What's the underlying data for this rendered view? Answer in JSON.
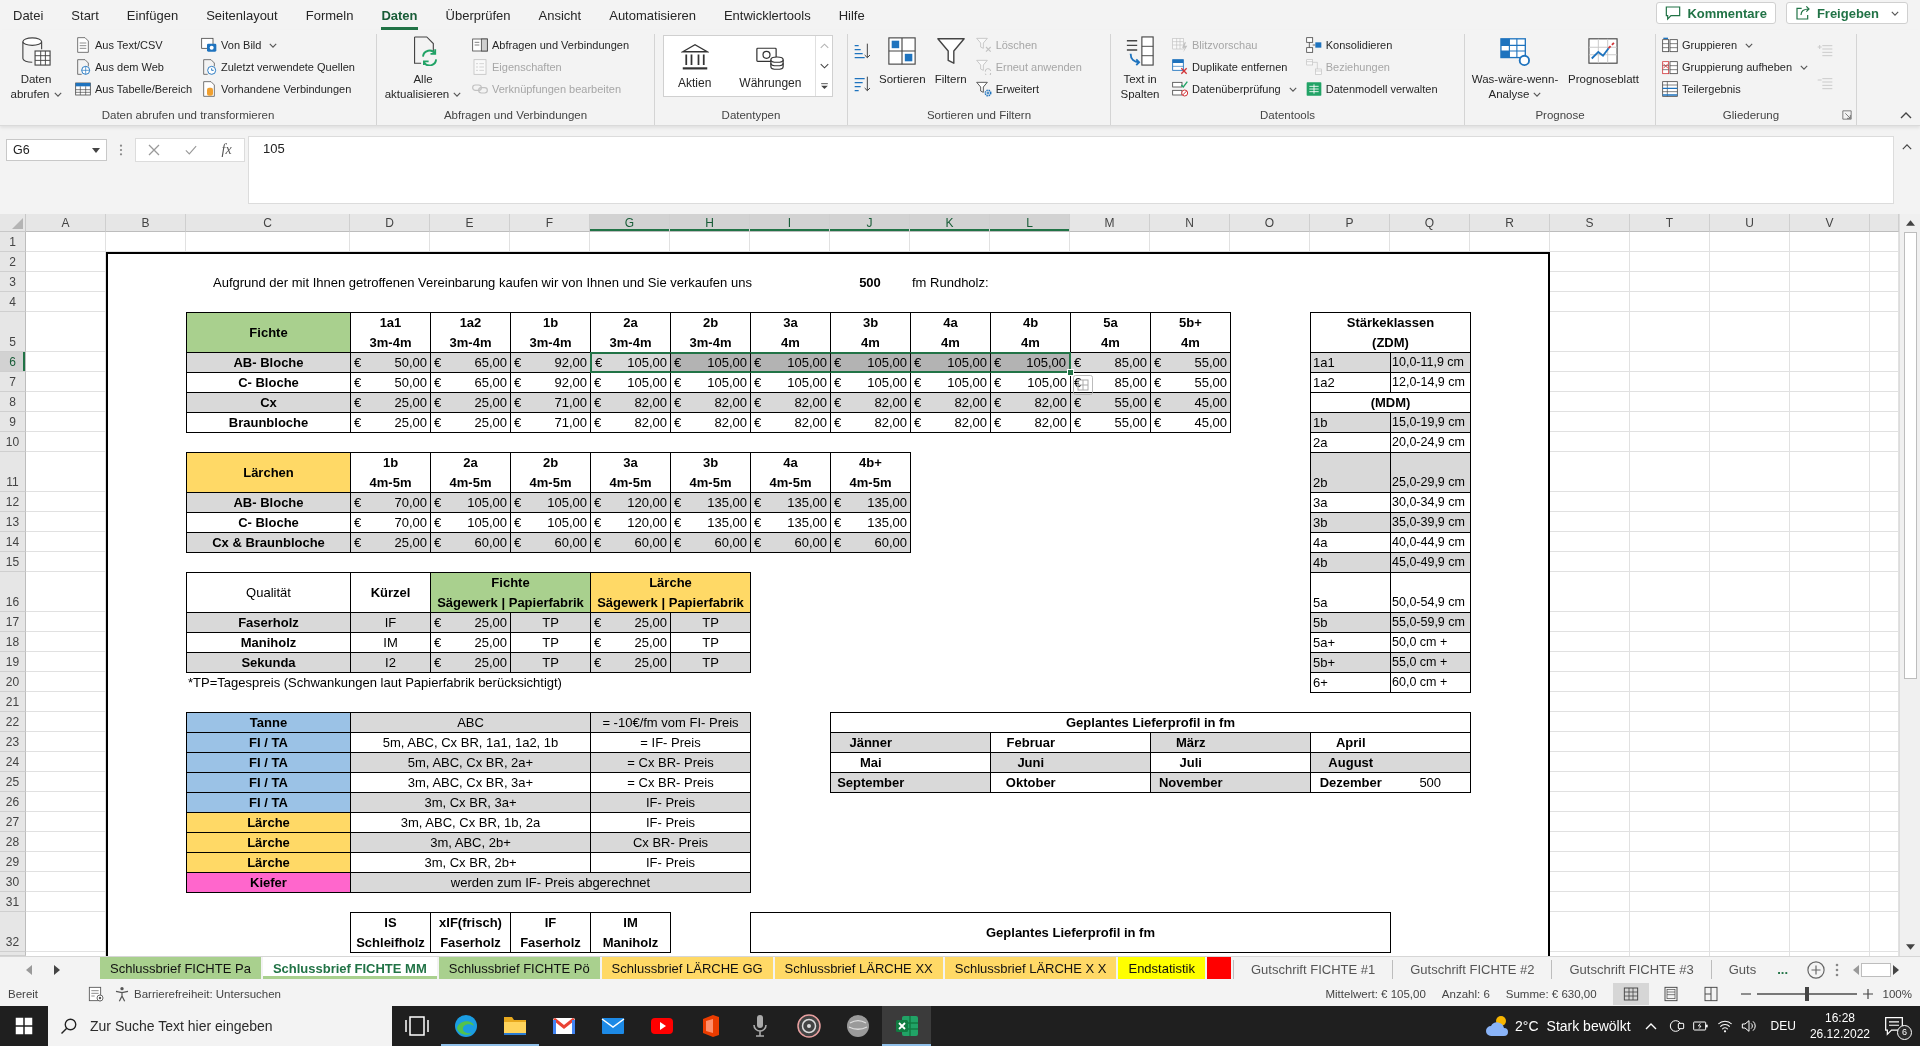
{
  "menu_tabs": [
    {
      "label": "Datei",
      "selected": false
    },
    {
      "label": "Start",
      "selected": false
    },
    {
      "label": "Einfügen",
      "selected": false
    },
    {
      "label": "Seitenlayout",
      "selected": false
    },
    {
      "label": "Formeln",
      "selected": false
    },
    {
      "label": "Daten",
      "selected": true
    },
    {
      "label": "Überprüfen",
      "selected": false
    },
    {
      "label": "Ansicht",
      "selected": false
    },
    {
      "label": "Automatisieren",
      "selected": false
    },
    {
      "label": "Entwicklertools",
      "selected": false
    },
    {
      "label": "Hilfe",
      "selected": false
    }
  ],
  "header_buttons": [
    {
      "kind": "comments",
      "label": "Kommentare",
      "dropdown": false
    },
    {
      "kind": "share",
      "label": "Freigeben",
      "dropdown": true
    }
  ],
  "ribbon_groups": [
    {
      "label": "Daten abrufen und transformieren",
      "launcher": false,
      "items": [
        {
          "kind": "large",
          "label": "Daten abrufen",
          "dropdown": true,
          "disabled": false
        },
        {
          "kind": "small",
          "label": "Aus Text/CSV",
          "dropdown": false,
          "disabled": false
        },
        {
          "kind": "small",
          "label": "Aus dem Web",
          "dropdown": false,
          "disabled": false
        },
        {
          "kind": "small",
          "label": "Aus Tabelle/Bereich",
          "dropdown": false,
          "disabled": false
        },
        {
          "kind": "small",
          "label": "Von Bild",
          "dropdown": true,
          "disabled": false
        },
        {
          "kind": "small",
          "label": "Zuletzt verwendete Quellen",
          "dropdown": false,
          "disabled": false
        },
        {
          "kind": "small",
          "label": "Vorhandene Verbindungen",
          "dropdown": false,
          "disabled": false
        }
      ]
    },
    {
      "label": "Abfragen und Verbindungen",
      "launcher": false,
      "items": [
        {
          "kind": "large",
          "label": "Alle aktualisieren",
          "dropdown": true,
          "disabled": false
        },
        {
          "kind": "small",
          "label": "Abfragen und Verbindungen",
          "dropdown": false,
          "disabled": false
        },
        {
          "kind": "small",
          "label": "Eigenschaften",
          "dropdown": false,
          "disabled": true
        },
        {
          "kind": "small",
          "label": "Verknüpfungen bearbeiten",
          "dropdown": false,
          "disabled": true
        }
      ]
    },
    {
      "label": "Datentypen",
      "launcher": false,
      "items": [
        {
          "kind": "tile",
          "label": "Aktien",
          "dropdown": false,
          "disabled": false
        },
        {
          "kind": "tile",
          "label": "Währungen",
          "dropdown": false,
          "disabled": false
        }
      ]
    },
    {
      "label": "Sortieren und Filtern",
      "launcher": false,
      "items": [
        {
          "kind": "icon",
          "dropdown": false,
          "disabled": false
        },
        {
          "kind": "icon",
          "dropdown": false,
          "disabled": false
        },
        {
          "kind": "large",
          "label": "Sortieren",
          "dropdown": false,
          "disabled": false
        },
        {
          "kind": "large",
          "label": "Filtern",
          "dropdown": false,
          "disabled": false
        },
        {
          "kind": "small",
          "label": "Löschen",
          "dropdown": false,
          "disabled": true
        },
        {
          "kind": "small",
          "label": "Erneut anwenden",
          "dropdown": false,
          "disabled": true
        },
        {
          "kind": "small",
          "label": "Erweitert",
          "dropdown": false,
          "disabled": false
        }
      ]
    },
    {
      "label": "Datentools",
      "launcher": false,
      "items": [
        {
          "kind": "large",
          "label": "Text in Spalten",
          "dropdown": false,
          "disabled": false
        },
        {
          "kind": "small",
          "label": "Blitzvorschau",
          "dropdown": false,
          "disabled": true
        },
        {
          "kind": "small",
          "label": "Duplikate entfernen",
          "dropdown": false,
          "disabled": false
        },
        {
          "kind": "small",
          "label": "Datenüberprüfung",
          "dropdown": true,
          "disabled": false
        },
        {
          "kind": "small",
          "label": "Konsolidieren",
          "dropdown": false,
          "disabled": false
        },
        {
          "kind": "small",
          "label": "Beziehungen",
          "dropdown": false,
          "disabled": true
        },
        {
          "kind": "small",
          "label": "Datenmodell verwalten",
          "dropdown": false,
          "disabled": false
        }
      ]
    },
    {
      "label": "Prognose",
      "launcher": false,
      "items": [
        {
          "kind": "large",
          "label": "Was-wäre-wenn-Analyse",
          "dropdown": true,
          "disabled": false
        },
        {
          "kind": "large",
          "label": "Prognoseblatt",
          "dropdown": false,
          "disabled": false
        }
      ]
    },
    {
      "label": "Gliederung",
      "launcher": true,
      "items": [
        {
          "kind": "small",
          "label": "Gruppieren",
          "dropdown": true,
          "disabled": false
        },
        {
          "kind": "small",
          "label": "Gruppierung aufheben",
          "dropdown": true,
          "disabled": false
        },
        {
          "kind": "small",
          "label": "Teilergebnis",
          "dropdown": false,
          "disabled": false
        },
        {
          "kind": "icon",
          "dropdown": false,
          "disabled": true
        },
        {
          "kind": "icon",
          "dropdown": false,
          "disabled": true
        }
      ]
    }
  ],
  "formula_bar": {
    "name_box": "G6",
    "function_label": "fx",
    "value": "105"
  },
  "columns": [
    {
      "label": "A",
      "selected": false
    },
    {
      "label": "B",
      "selected": false
    },
    {
      "label": "C",
      "selected": false
    },
    {
      "label": "D",
      "selected": false
    },
    {
      "label": "E",
      "selected": false
    },
    {
      "label": "F",
      "selected": false
    },
    {
      "label": "G",
      "selected": true
    },
    {
      "label": "H",
      "selected": true
    },
    {
      "label": "I",
      "selected": true
    },
    {
      "label": "J",
      "selected": true
    },
    {
      "label": "K",
      "selected": true
    },
    {
      "label": "L",
      "selected": true
    },
    {
      "label": "M",
      "selected": false
    },
    {
      "label": "N",
      "selected": false
    },
    {
      "label": "O",
      "selected": false
    },
    {
      "label": "P",
      "selected": false
    },
    {
      "label": "Q",
      "selected": false
    },
    {
      "label": "R",
      "selected": false
    },
    {
      "label": "S",
      "selected": false
    },
    {
      "label": "T",
      "selected": false
    },
    {
      "label": "U",
      "selected": false
    },
    {
      "label": "V",
      "selected": false
    }
  ],
  "rows": [
    {
      "label": "1",
      "selected": false
    },
    {
      "label": "2",
      "selected": false
    },
    {
      "label": "3",
      "selected": false
    },
    {
      "label": "4",
      "selected": false
    },
    {
      "label": "5",
      "selected": false
    },
    {
      "label": "6",
      "selected": true
    },
    {
      "label": "7",
      "selected": false
    },
    {
      "label": "8",
      "selected": false
    },
    {
      "label": "9",
      "selected": false
    },
    {
      "label": "10",
      "selected": false
    },
    {
      "label": "11",
      "selected": false
    },
    {
      "label": "12",
      "selected": false
    },
    {
      "label": "13",
      "selected": false
    },
    {
      "label": "14",
      "selected": false
    },
    {
      "label": "15",
      "selected": false
    },
    {
      "label": "16",
      "selected": false
    },
    {
      "label": "17",
      "selected": false
    },
    {
      "label": "18",
      "selected": false
    },
    {
      "label": "19",
      "selected": false
    },
    {
      "label": "20",
      "selected": false
    },
    {
      "label": "21",
      "selected": false
    },
    {
      "label": "22",
      "selected": false
    },
    {
      "label": "23",
      "selected": false
    },
    {
      "label": "24",
      "selected": false
    },
    {
      "label": "25",
      "selected": false
    },
    {
      "label": "26",
      "selected": false
    },
    {
      "label": "27",
      "selected": false
    },
    {
      "label": "28",
      "selected": false
    },
    {
      "label": "29",
      "selected": false
    },
    {
      "label": "30",
      "selected": false
    },
    {
      "label": "31",
      "selected": false
    },
    {
      "label": "32",
      "selected": false
    }
  ],
  "sheet": {
    "intro": {
      "text": "Aufgrund der mit Ihnen getroffenen Vereinbarung kaufen wir von Ihnen und Sie verkaufen uns",
      "amount": "500",
      "unit": "fm Rundholz:"
    },
    "price_tables": [
      {
        "title": "Fichte",
        "color": "#a9d08e",
        "columns": [
          {
            "grade": "1a1",
            "length": "3m-4m"
          },
          {
            "grade": "1a2",
            "length": "3m-4m"
          },
          {
            "grade": "1b",
            "length": "3m-4m"
          },
          {
            "grade": "2a",
            "length": "3m-4m"
          },
          {
            "grade": "2b",
            "length": "3m-4m"
          },
          {
            "grade": "3a",
            "length": "4m"
          },
          {
            "grade": "3b",
            "length": "4m"
          },
          {
            "grade": "4a",
            "length": "4m"
          },
          {
            "grade": "4b",
            "length": "4m"
          },
          {
            "grade": "5a",
            "length": "4m"
          },
          {
            "grade": "5b+",
            "length": "4m"
          }
        ],
        "rows": [
          {
            "label": "AB- Bloche",
            "shaded": true,
            "values": [
              {
                "currency": "€",
                "amount": "50,00",
                "selected": false
              },
              {
                "currency": "€",
                "amount": "65,00",
                "selected": false
              },
              {
                "currency": "€",
                "amount": "92,00",
                "selected": false
              },
              {
                "currency": "€",
                "amount": "105,00",
                "selected": true
              },
              {
                "currency": "€",
                "amount": "105,00",
                "selected": true
              },
              {
                "currency": "€",
                "amount": "105,00",
                "selected": true
              },
              {
                "currency": "€",
                "amount": "105,00",
                "selected": true
              },
              {
                "currency": "€",
                "amount": "105,00",
                "selected": true
              },
              {
                "currency": "€",
                "amount": "105,00",
                "selected": true
              },
              {
                "currency": "€",
                "amount": "85,00",
                "selected": false
              },
              {
                "currency": "€",
                "amount": "55,00",
                "selected": false
              }
            ]
          },
          {
            "label": "C- Bloche",
            "shaded": false,
            "values": [
              {
                "currency": "€",
                "amount": "50,00",
                "selected": false
              },
              {
                "currency": "€",
                "amount": "65,00",
                "selected": false
              },
              {
                "currency": "€",
                "amount": "92,00",
                "selected": false
              },
              {
                "currency": "€",
                "amount": "105,00",
                "selected": false
              },
              {
                "currency": "€",
                "amount": "105,00",
                "selected": false
              },
              {
                "currency": "€",
                "amount": "105,00",
                "selected": false
              },
              {
                "currency": "€",
                "amount": "105,00",
                "selected": false
              },
              {
                "currency": "€",
                "amount": "105,00",
                "selected": false
              },
              {
                "currency": "€",
                "amount": "105,00",
                "selected": false
              },
              {
                "currency": "€",
                "amount": "85,00",
                "selected": false
              },
              {
                "currency": "€",
                "amount": "55,00",
                "selected": false
              }
            ]
          },
          {
            "label": "Cx",
            "shaded": true,
            "values": [
              {
                "currency": "€",
                "amount": "25,00",
                "selected": false
              },
              {
                "currency": "€",
                "amount": "25,00",
                "selected": false
              },
              {
                "currency": "€",
                "amount": "71,00",
                "selected": false
              },
              {
                "currency": "€",
                "amount": "82,00",
                "selected": false
              },
              {
                "currency": "€",
                "amount": "82,00",
                "selected": false
              },
              {
                "currency": "€",
                "amount": "82,00",
                "selected": false
              },
              {
                "currency": "€",
                "amount": "82,00",
                "selected": false
              },
              {
                "currency": "€",
                "amount": "82,00",
                "selected": false
              },
              {
                "currency": "€",
                "amount": "82,00",
                "selected": false
              },
              {
                "currency": "€",
                "amount": "55,00",
                "selected": false
              },
              {
                "currency": "€",
                "amount": "45,00",
                "selected": false
              }
            ]
          },
          {
            "label": "Braunbloche",
            "shaded": false,
            "values": [
              {
                "currency": "€",
                "amount": "25,00",
                "selected": false
              },
              {
                "currency": "€",
                "amount": "25,00",
                "selected": false
              },
              {
                "currency": "€",
                "amount": "71,00",
                "selected": false
              },
              {
                "currency": "€",
                "amount": "82,00",
                "selected": false
              },
              {
                "currency": "€",
                "amount": "82,00",
                "selected": false
              },
              {
                "currency": "€",
                "amount": "82,00",
                "selected": false
              },
              {
                "currency": "€",
                "amount": "82,00",
                "selected": false
              },
              {
                "currency": "€",
                "amount": "82,00",
                "selected": false
              },
              {
                "currency": "€",
                "amount": "82,00",
                "selected": false
              },
              {
                "currency": "€",
                "amount": "55,00",
                "selected": false
              },
              {
                "currency": "€",
                "amount": "45,00",
                "selected": false
              }
            ]
          }
        ]
      },
      {
        "title": "Lärchen",
        "color": "#ffd966",
        "columns": [
          {
            "grade": "1b",
            "length": "4m-5m"
          },
          {
            "grade": "2a",
            "length": "4m-5m"
          },
          {
            "grade": "2b",
            "length": "4m-5m"
          },
          {
            "grade": "3a",
            "length": "4m-5m"
          },
          {
            "grade": "3b",
            "length": "4m-5m"
          },
          {
            "grade": "4a",
            "length": "4m-5m"
          },
          {
            "grade": "4b+",
            "length": "4m-5m"
          }
        ],
        "rows": [
          {
            "label": "AB- Bloche",
            "shaded": true,
            "values": [
              {
                "currency": "€",
                "amount": "70,00"
              },
              {
                "currency": "€",
                "amount": "105,00"
              },
              {
                "currency": "€",
                "amount": "105,00"
              },
              {
                "currency": "€",
                "amount": "120,00"
              },
              {
                "currency": "€",
                "amount": "135,00"
              },
              {
                "currency": "€",
                "amount": "135,00"
              },
              {
                "currency": "€",
                "amount": "135,00"
              }
            ]
          },
          {
            "label": "C- Bloche",
            "shaded": false,
            "values": [
              {
                "currency": "€",
                "amount": "70,00"
              },
              {
                "currency": "€",
                "amount": "105,00"
              },
              {
                "currency": "€",
                "amount": "105,00"
              },
              {
                "currency": "€",
                "amount": "120,00"
              },
              {
                "currency": "€",
                "amount": "135,00"
              },
              {
                "currency": "€",
                "amount": "135,00"
              },
              {
                "currency": "€",
                "amount": "135,00"
              }
            ]
          },
          {
            "label": "Cx & Braunbloche",
            "shaded": true,
            "values": [
              {
                "currency": "€",
                "amount": "25,00"
              },
              {
                "currency": "€",
                "amount": "60,00"
              },
              {
                "currency": "€",
                "amount": "60,00"
              },
              {
                "currency": "€",
                "amount": "60,00"
              },
              {
                "currency": "€",
                "amount": "60,00"
              },
              {
                "currency": "€",
                "amount": "60,00"
              },
              {
                "currency": "€",
                "amount": "60,00"
              }
            ]
          }
        ]
      }
    ],
    "quality_table": {
      "headers": [
        "Qualität",
        "Kürzel"
      ],
      "groups": [
        {
          "title": "Fichte",
          "subtitle": "Sägewerk | Papierfabrik",
          "color": "#a9d08e"
        },
        {
          "title": "Lärche",
          "subtitle": "Sägewerk | Papierfabrik",
          "color": "#ffd966"
        }
      ],
      "rows": [
        {
          "label": "Faserholz",
          "code": "IF",
          "shaded": true,
          "prices": [
            {
              "currency": "€",
              "amount": "25,00",
              "paper_mill": "TP"
            },
            {
              "currency": "€",
              "amount": "25,00",
              "paper_mill": "TP"
            }
          ]
        },
        {
          "label": "Maniholz",
          "code": "IM",
          "shaded": false,
          "prices": [
            {
              "currency": "€",
              "amount": "25,00",
              "paper_mill": "TP"
            },
            {
              "currency": "€",
              "amount": "25,00",
              "paper_mill": "TP"
            }
          ]
        },
        {
          "label": "Sekunda",
          "code": "I2",
          "shaded": true,
          "prices": [
            {
              "currency": "€",
              "amount": "25,00",
              "paper_mill": "TP"
            },
            {
              "currency": "€",
              "amount": "25,00",
              "paper_mill": "TP"
            }
          ]
        }
      ]
    },
    "footnote": "*TP=Tagespreis (Schwankungen laut Papierfabrik berücksichtigt)",
    "rules": [
      {
        "kind": "split",
        "species": "Tanne",
        "color": "#9bc2e6",
        "assortment": "ABC",
        "price": "= -10€/fm vom FI- Preis",
        "shaded": true
      },
      {
        "kind": "split",
        "species": "FI / TA",
        "color": "#9bc2e6",
        "assortment": "5m, ABC, Cx BR, 1a1, 1a2, 1b",
        "price": "= IF- Preis",
        "shaded": false
      },
      {
        "kind": "split",
        "species": "FI / TA",
        "color": "#9bc2e6",
        "assortment": "5m, ABC, Cx BR, 2a+",
        "price": "= Cx BR- Preis",
        "shaded": true
      },
      {
        "kind": "split",
        "species": "FI / TA",
        "color": "#9bc2e6",
        "assortment": "3m, ABC, Cx BR, 3a+",
        "price": "= Cx BR- Preis",
        "shaded": false
      },
      {
        "kind": "split",
        "species": "FI / TA",
        "color": "#9bc2e6",
        "assortment": "3m, Cx BR, 3a+",
        "price": "IF- Preis",
        "shaded": true
      },
      {
        "kind": "split",
        "species": "Lärche",
        "color": "#ffd966",
        "assortment": "3m, ABC, Cx BR, 1b, 2a",
        "price": "IF- Preis",
        "shaded": false
      },
      {
        "kind": "split",
        "species": "Lärche",
        "color": "#ffd966",
        "assortment": "3m, ABC, 2b+",
        "price": "Cx BR- Preis",
        "shaded": true
      },
      {
        "kind": "split",
        "species": "Lärche",
        "color": "#ffd966",
        "assortment": "3m, Cx BR, 2b+",
        "price": "IF- Preis",
        "shaded": false
      },
      {
        "kind": "merged",
        "species": "Kiefer",
        "color": "#ff66cc",
        "note": "werden zum IF- Preis abgerechnet",
        "shaded": true
      }
    ],
    "diameter_classes": {
      "title": "Stärkeklassen",
      "subtitle": "(ZDM)",
      "rows": [
        {
          "kind": "class",
          "grade": "1a1",
          "range": "10,0-11,9 cm",
          "shaded": true
        },
        {
          "kind": "class",
          "grade": "1a2",
          "range": "12,0-14,9 cm",
          "shaded": false
        },
        {
          "kind": "heading",
          "label": "(MDM)",
          "shaded": false
        },
        {
          "kind": "class",
          "grade": "1b",
          "range": "15,0-19,9 cm",
          "shaded": true
        },
        {
          "kind": "class",
          "grade": "2a",
          "range": "20,0-24,9 cm",
          "shaded": false
        },
        {
          "kind": "class",
          "grade": "2b",
          "range": "25,0-29,9 cm",
          "shaded": true
        },
        {
          "kind": "class",
          "grade": "3a",
          "range": "30,0-34,9 cm",
          "shaded": false
        },
        {
          "kind": "class",
          "grade": "3b",
          "range": "35,0-39,9 cm",
          "shaded": true
        },
        {
          "kind": "class",
          "grade": "4a",
          "range": "40,0-44,9 cm",
          "shaded": false
        },
        {
          "kind": "class",
          "grade": "4b",
          "range": "45,0-49,9 cm",
          "shaded": true
        },
        {
          "kind": "class",
          "grade": "5a",
          "range": "50,0-54,9 cm",
          "shaded": false
        },
        {
          "kind": "class",
          "grade": "5b",
          "range": "55,0-59,9 cm",
          "shaded": true
        },
        {
          "kind": "class",
          "grade": "5a+",
          "range": "50,0 cm +",
          "shaded": false
        },
        {
          "kind": "class",
          "grade": "5b+",
          "range": "55,0 cm +",
          "shaded": true
        },
        {
          "kind": "class",
          "grade": "6+",
          "range": "60,0 cm +",
          "shaded": false
        }
      ]
    },
    "delivery_profile": {
      "title": "Geplantes Lieferprofil in fm",
      "months": [
        {
          "name": "Jänner",
          "shaded": true
        },
        {
          "name": "Februar",
          "shaded": false
        },
        {
          "name": "März",
          "shaded": true
        },
        {
          "name": "April",
          "shaded": false
        },
        {
          "name": "Mai",
          "shaded": false
        },
        {
          "name": "Juni",
          "shaded": true
        },
        {
          "name": "Juli",
          "shaded": false
        },
        {
          "name": "August",
          "shaded": true
        },
        {
          "name": "September",
          "shaded": true
        },
        {
          "name": "Oktober",
          "shaded": false
        },
        {
          "name": "November",
          "shaded": true
        },
        {
          "name": "Dezember",
          "value": "500",
          "shaded": false
        }
      ]
    },
    "assortment_headers": [
      {
        "code": "IS",
        "name": "Schleifholz"
      },
      {
        "code": "xIF(frisch)",
        "name": "Faserholz"
      },
      {
        "code": "IF",
        "name": "Faserholz"
      },
      {
        "code": "IM",
        "name": "Maniholz"
      }
    ],
    "second_profile_title": "Geplantes Lieferprofil in fm"
  },
  "sheet_tabs": [
    {
      "label": "Schlussbrief FICHTE Pa",
      "color": "#a9d08e",
      "selected": false
    },
    {
      "label": "Schlussbrief FICHTE MM",
      "color": "#a9d08e",
      "selected": true
    },
    {
      "label": "Schlussbrief FICHTE Pö",
      "color": "#a9d08e",
      "selected": false
    },
    {
      "label": "Schlussbrief LÄRCHE GG",
      "color": "#ffd966",
      "selected": false
    },
    {
      "label": "Schlussbrief LÄRCHE XX",
      "color": "#ffd966",
      "selected": false
    },
    {
      "label": "Schlussbrief LÄRCHE X X",
      "color": "#ffd966",
      "selected": false
    },
    {
      "label": "Endstatistik",
      "color": "#ffff00",
      "selected": false
    },
    {
      "color": "#ff0000",
      "selected": false
    },
    {
      "label": "Gutschrift FICHTE #1",
      "selected": false
    },
    {
      "label": "Gutschrift FICHTE #2",
      "selected": false
    },
    {
      "label": "Gutschrift FICHTE #3",
      "selected": false
    },
    {
      "label": "Guts",
      "selected": false
    }
  ],
  "more_tabs": "...",
  "status_bar": {
    "mode": "Bereit",
    "accessibility": "Barrierefreiheit: Untersuchen",
    "statistics": [
      "Mittelwert: € 105,00",
      "Anzahl: 6",
      "Summe: € 630,00"
    ],
    "views": [
      {
        "selected": true
      },
      {
        "selected": false
      },
      {
        "selected": false
      }
    ],
    "zoom": {
      "level": 0.5,
      "label": "100%"
    }
  },
  "taskbar": {
    "search_placeholder": "Zur Suche Text hier eingeben",
    "apps": [
      {
        "running": false,
        "selected": false
      },
      {
        "running": true,
        "selected": false
      },
      {
        "running": true,
        "selected": false
      },
      {
        "running": false,
        "selected": false
      },
      {
        "running": false,
        "selected": false
      },
      {
        "running": false,
        "selected": false
      },
      {
        "running": false,
        "selected": false
      },
      {
        "running": false,
        "selected": false
      },
      {
        "running": false,
        "selected": false
      },
      {
        "running": false,
        "selected": false
      },
      {
        "running": true,
        "selected": true
      }
    ],
    "weather": {
      "temperature": "2°C",
      "condition": "Stark bewölkt"
    },
    "language": "DEU",
    "time": "16:28",
    "date": "26.12.2022",
    "notification_count": "6"
  }
}
